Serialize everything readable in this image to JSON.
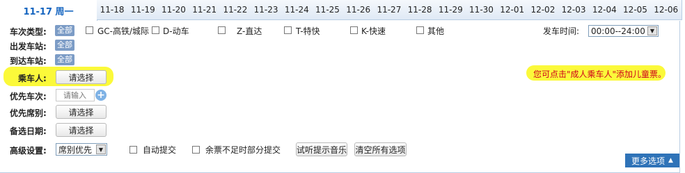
{
  "tabs": {
    "active": "11-17 周一",
    "dates": [
      "11-18",
      "11-19",
      "11-20",
      "11-21",
      "11-22",
      "11-23",
      "11-24",
      "11-25",
      "11-26",
      "11-27",
      "11-28",
      "11-29",
      "11-30",
      "12-01",
      "12-02",
      "12-03",
      "12-04",
      "12-05",
      "12-06"
    ]
  },
  "filters": {
    "train_type_label": "车次类型:",
    "all": "全部",
    "train_types": [
      "GC-高铁/城际",
      "D-动车",
      "Z-直达",
      "T-特快",
      "K-快速",
      "其他"
    ],
    "depart_station_label": "出发车站:",
    "arrive_station_label": "到达车站:",
    "depart_time_label": "发车时间:",
    "depart_time_value": "00:00--24:00"
  },
  "passenger": {
    "label": "乘车人:",
    "button": "请选择"
  },
  "priority_train": {
    "label": "优先车次:",
    "placeholder": "请输入"
  },
  "priority_seat": {
    "label": "优先席别:",
    "button": "请选择"
  },
  "backup_date": {
    "label": "备选日期:",
    "button": "请选择"
  },
  "advanced": {
    "label": "高级设置:",
    "select_value": "席别优先",
    "auto_submit": "自动提交",
    "partial_submit": "余票不足时部分提交",
    "test_music": "试听提示音乐",
    "clear_all": "清空所有选项"
  },
  "notice": "您可点击\"成人乘车人\"添加儿童票。",
  "more_options": "更多选项",
  "colors": {
    "accent": "#1565c0",
    "pill": "#7c9cc6",
    "highlight": "#fbf93a",
    "notice": "#d0021b",
    "more_bg": "#2f73b8"
  }
}
